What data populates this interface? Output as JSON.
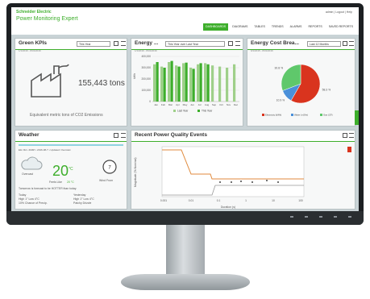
{
  "app": {
    "brand": "Schneider Electric",
    "title": "Power Monitoring Expert",
    "user_links": "admin | Logout | Help"
  },
  "nav": {
    "items": [
      {
        "label": "DASHBOARDS",
        "active": true
      },
      {
        "label": "DIAGRAMS",
        "active": false
      },
      {
        "label": "TABLES",
        "active": false
      },
      {
        "label": "TRENDS",
        "active": false
      },
      {
        "label": "ALARMS",
        "active": false
      },
      {
        "label": "REPORTS",
        "active": false
      },
      {
        "label": "SAVED REPORTS",
        "active": false
      }
    ]
  },
  "green_kpis": {
    "title": "Green KPIs",
    "period": "This Year",
    "date_range": "1/1/2016 - 8/31/2016",
    "value": "155,443 tons",
    "description": "Equivalent metric tons of CO2 Emissions"
  },
  "energy": {
    "title": "Energy ...",
    "period": "This Year over Last Year",
    "date_range": "1/1/2016 - 8/31/2016",
    "legend": [
      "Last Year",
      "This Year"
    ]
  },
  "energy_cost": {
    "title": "Energy Cost Brea...",
    "period": "Last 12 Months",
    "date_range": "9/1/2015 - 8/31/2016",
    "legend": [
      "Electricity (kWh)",
      "Water (m3/hr)",
      "Gas (CF)"
    ]
  },
  "weather": {
    "title": "Weather",
    "location": "Elm Rd • 4M4P • 2016-08-? • Updated: Overcast",
    "condition": "Overcast",
    "temp": "20",
    "unit": "°C",
    "feels_like_label": "Feels Like",
    "feels_like": "20 °C",
    "wind_label": "Wind From",
    "wind_value": "7",
    "forecast_text": "Tomorrow is forecast to be HOTTER than today.",
    "today_label": "Today",
    "today_hilo": "High 1° Low 4°C",
    "today_precip": "10% Chance of Precip.",
    "yesterday_label": "Yesterday",
    "yesterday_hilo": "High 1° Low 4°C",
    "yesterday_cond": "Patchy Drizzle"
  },
  "power_quality": {
    "title": "Recent Power Quality Events",
    "ylabel": "Magnitude (% Nominal)",
    "xlabel": "Duration (s)",
    "xticks": [
      "0.001",
      "0.01",
      "0.1",
      "1",
      "10",
      "100"
    ]
  },
  "chart_data": [
    {
      "type": "bar",
      "title": "Energy ...",
      "categories": [
        "Jan",
        "Feb",
        "Mar",
        "Apr",
        "May",
        "Jun",
        "Jul",
        "Aug",
        "Sep",
        "Oct",
        "Nov",
        "Dec"
      ],
      "ylabel": "kWh",
      "ylim": [
        0,
        400000
      ],
      "yticks": [
        "400,000",
        "300,000",
        "200,000",
        "100,000",
        "0"
      ],
      "series": [
        {
          "name": "Last Year",
          "color": "#9fd08a",
          "values": [
            330000,
            310000,
            350000,
            320000,
            340000,
            300000,
            330000,
            340000,
            320000,
            310000,
            300000,
            330000
          ]
        },
        {
          "name": "This Year",
          "color": "#3dae2b",
          "values": [
            350000,
            300000,
            360000,
            310000,
            345000,
            290000,
            340000,
            330000,
            0,
            0,
            0,
            0
          ]
        }
      ]
    },
    {
      "type": "pie",
      "title": "Energy Cost Brea...",
      "slices": [
        {
          "name": "Electricity (kWh)",
          "value": 58.3,
          "color": "#d9341e"
        },
        {
          "name": "Water (m3/hr)",
          "value": 10.9,
          "color": "#4a90d9"
        },
        {
          "name": "Gas (CF)",
          "value": 30.8,
          "color": "#5fc86b"
        }
      ],
      "labels": [
        "30.8 %",
        "58.3 %",
        "10.9 %"
      ]
    }
  ]
}
